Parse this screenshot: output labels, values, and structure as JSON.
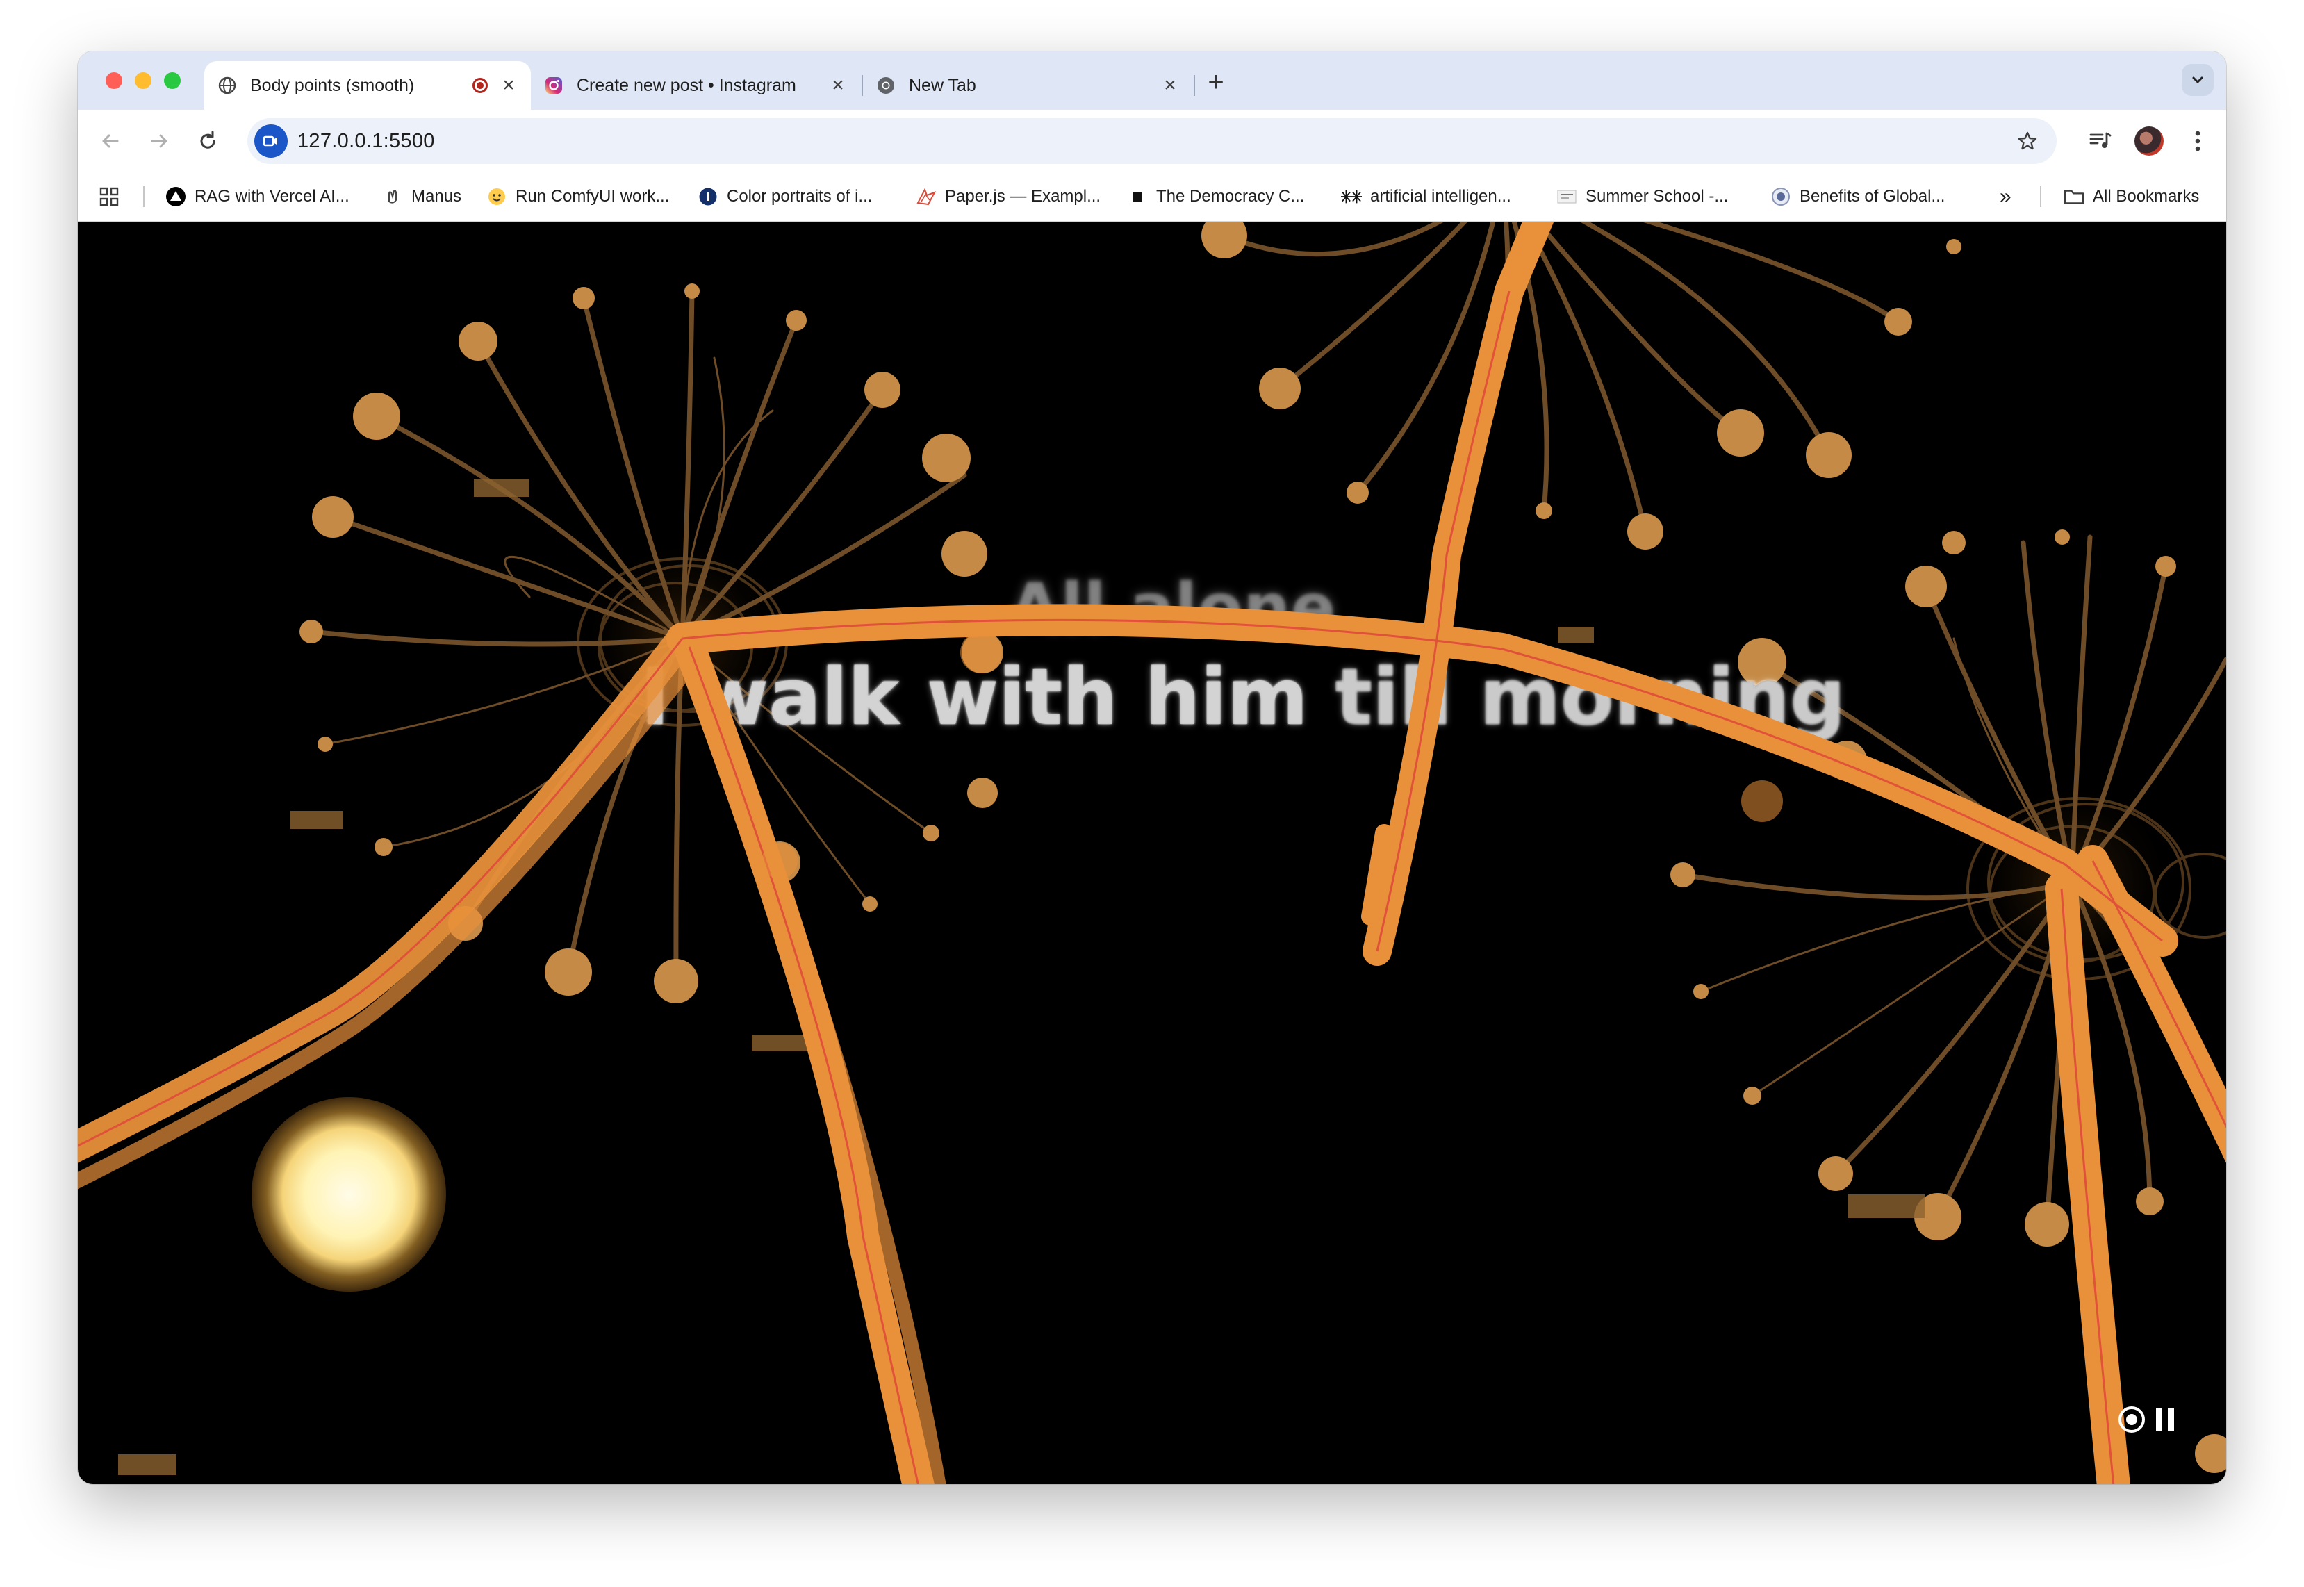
{
  "browser": {
    "tabs": [
      {
        "title": "Body points (smooth)",
        "favicon": "globe-icon",
        "active": true,
        "recording": true
      },
      {
        "title": "Create new post • Instagram",
        "favicon": "instagram-icon",
        "active": false
      },
      {
        "title": "New Tab",
        "favicon": "chrome-icon",
        "active": false
      }
    ],
    "url": "127.0.0.1:5500",
    "bookmarks": [
      {
        "label": "RAG with Vercel AI...",
        "icon": "vercel-icon"
      },
      {
        "label": "Manus",
        "icon": "manus-icon"
      },
      {
        "label": "Run ComfyUI work...",
        "icon": "hugging-face-icon"
      },
      {
        "label": "Color portraits of i...",
        "icon": "loc-icon"
      },
      {
        "label": "Paper.js — Exampl...",
        "icon": "paperjs-icon"
      },
      {
        "label": "The Democracy C...",
        "icon": "square-icon"
      },
      {
        "label": "artificial intelligen...",
        "icon": "sparkle-icon"
      },
      {
        "label": "Summer School -...",
        "icon": "summer-school-icon"
      },
      {
        "label": "Benefits of Global...",
        "icon": "seal-icon"
      }
    ],
    "all_bookmarks_label": "All Bookmarks",
    "overflow_label": "»"
  },
  "canvas": {
    "lyric_line_1": "All alone",
    "lyric_line_2_main": "I walk with him",
    "lyric_line_2_faded": " till morning",
    "background_color": "#000000",
    "stroke_color": "#e8903a",
    "accent_line_color": "#e04b3a",
    "node_color": "#c58a45"
  },
  "controls": {
    "record_icon": "record-icon",
    "pause_icon": "pause-icon"
  }
}
